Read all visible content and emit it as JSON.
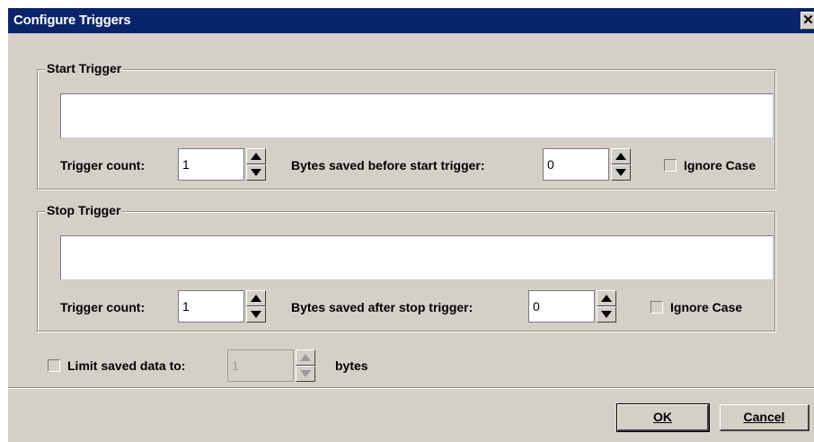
{
  "window": {
    "title": "Configure Triggers",
    "close_glyph": "✕"
  },
  "start_trigger": {
    "group_title": "Start Trigger",
    "pattern_value": "",
    "trigger_count_label": "Trigger count:",
    "trigger_count_value": "1",
    "bytes_label": "Bytes saved before start trigger:",
    "bytes_value": "0",
    "ignore_case_label": "Ignore Case",
    "ignore_case_checked": false
  },
  "stop_trigger": {
    "group_title": "Stop Trigger",
    "pattern_value": "",
    "trigger_count_label": "Trigger count:",
    "trigger_count_value": "1",
    "bytes_label": "Bytes saved after stop trigger:",
    "bytes_value": "0",
    "ignore_case_label": "Ignore Case",
    "ignore_case_checked": false
  },
  "limit": {
    "label": "Limit saved data to:",
    "checked": false,
    "value": "1",
    "unit": "bytes"
  },
  "buttons": {
    "ok": "OK",
    "cancel": "Cancel"
  },
  "colors": {
    "title_bar": "#0a246a",
    "dialog_bg": "#d4d0c8"
  }
}
